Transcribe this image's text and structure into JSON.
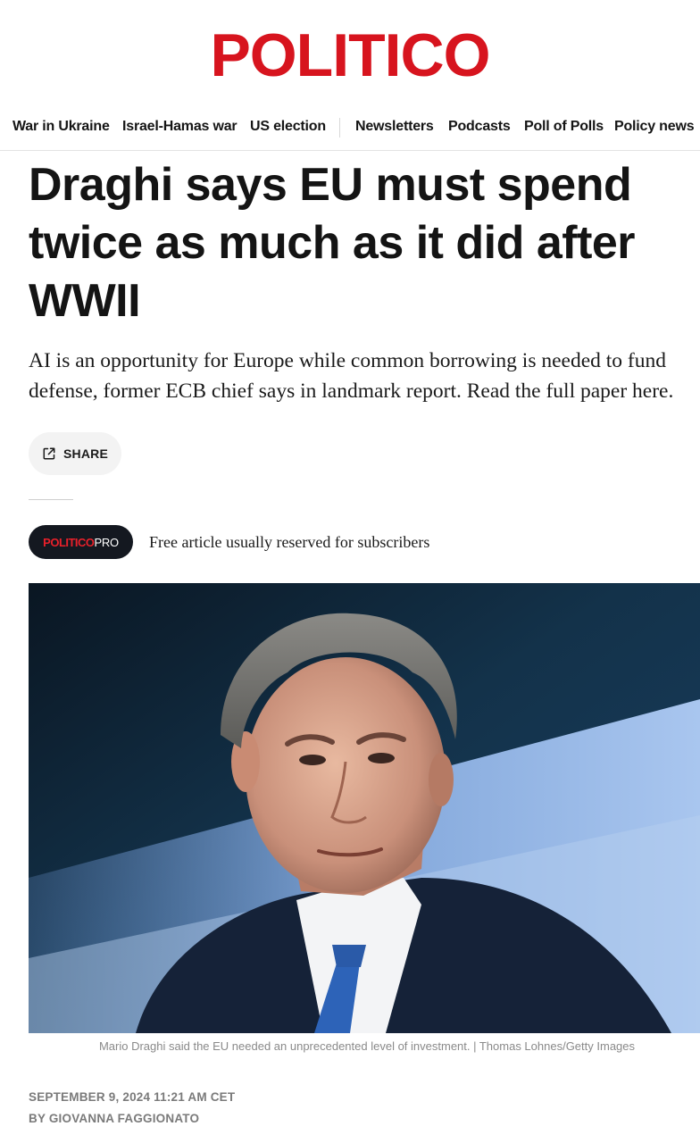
{
  "site": {
    "logo": "POLITICO",
    "brand_color": "#d7141e"
  },
  "nav": {
    "items": [
      {
        "label": "War in Ukraine"
      },
      {
        "label": "Israel-Hamas war"
      },
      {
        "label": "US election"
      },
      {
        "label": "Newsletters"
      },
      {
        "label": "Podcasts"
      },
      {
        "label": "Poll of Polls"
      },
      {
        "label": "Policy news"
      }
    ]
  },
  "article": {
    "headline_lines": [
      "Draghi says EU must spend",
      "twice as much as it did after",
      "WWII"
    ],
    "dek_lines": [
      "AI is an opportunity for Europe while common borrowing is needed to fund",
      "defense, former ECB chief says in landmark report. Read the full paper here."
    ],
    "share_label": "SHARE",
    "pro_badge": {
      "brand": "POLITICO",
      "suffix": "PRO"
    },
    "pro_note": "Free article usually reserved for subscribers",
    "image_caption": "Mario Draghi said the EU needed an unprecedented level of investment. | Thomas Lohnes/Getty Images",
    "dateline": "SEPTEMBER 9, 2024 11:21 AM CET",
    "byline": "BY GIOVANNA FAGGIONATO"
  },
  "icons": {
    "share": "share-external-icon"
  }
}
